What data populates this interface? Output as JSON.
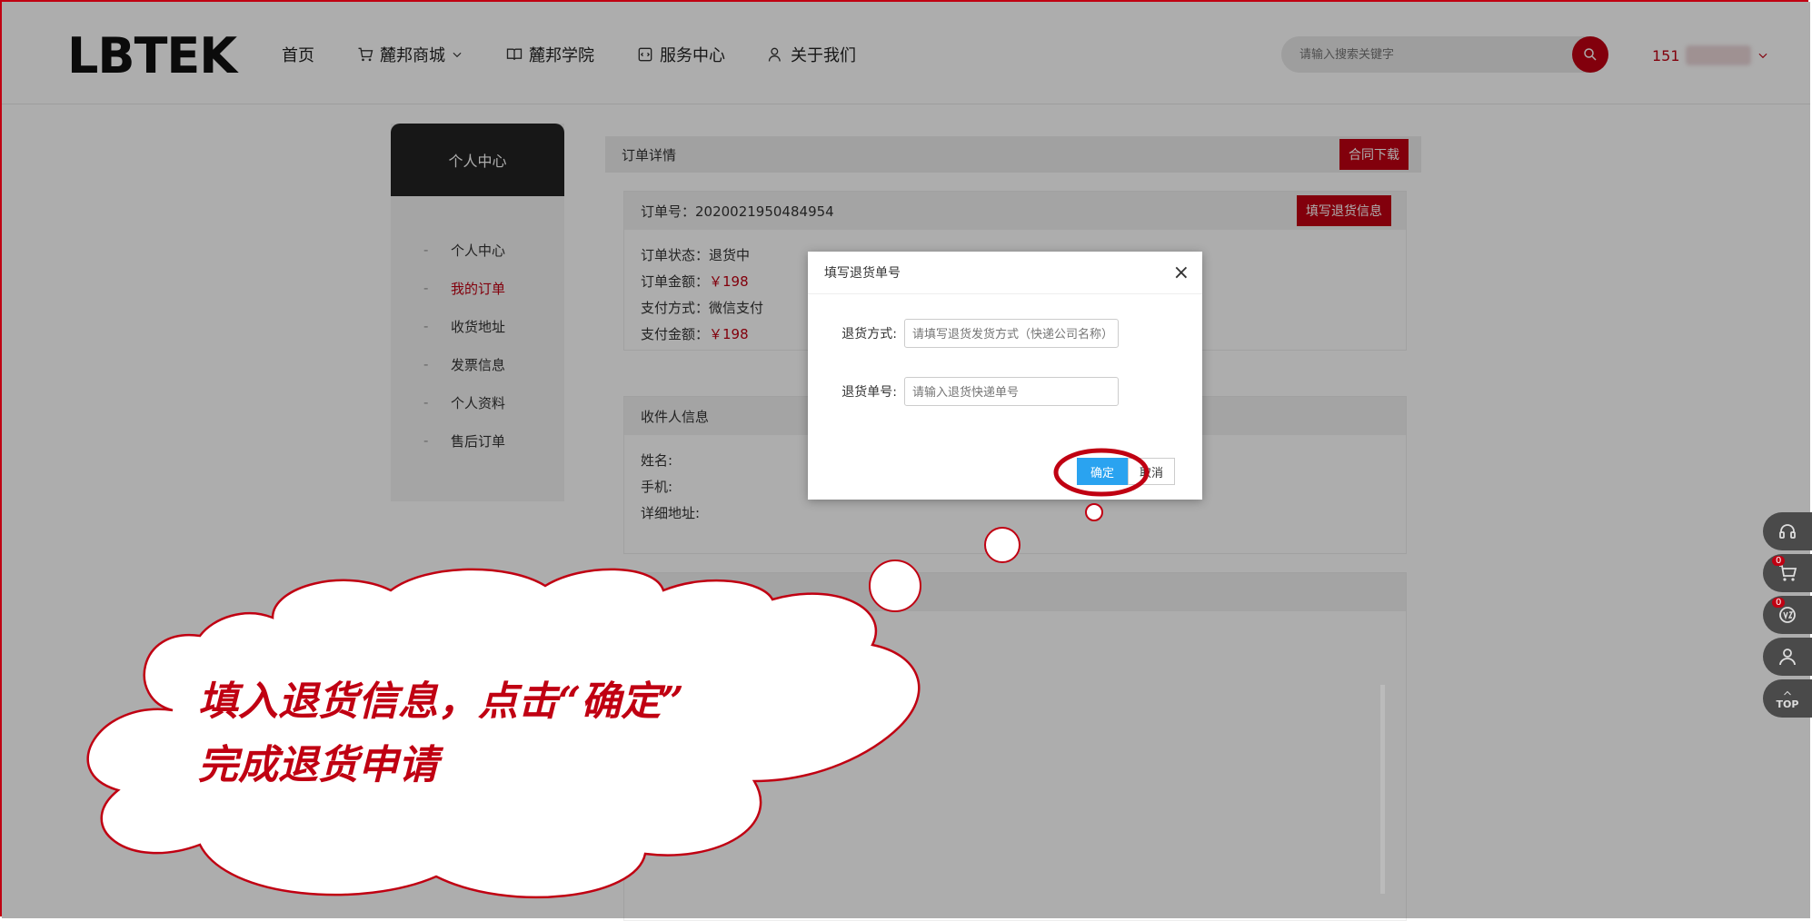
{
  "header": {
    "logo": "LBTEK",
    "nav": [
      "首页",
      "麓邦商城",
      "麓邦学院",
      "服务中心",
      "关于我们"
    ],
    "search_placeholder": "请输入搜索关键字",
    "user_prefix": "151"
  },
  "sidebar": {
    "title": "个人中心",
    "items": [
      {
        "label": "个人中心",
        "active": false
      },
      {
        "label": "我的订单",
        "active": true
      },
      {
        "label": "收货地址",
        "active": false
      },
      {
        "label": "发票信息",
        "active": false
      },
      {
        "label": "个人资料",
        "active": false
      },
      {
        "label": "售后订单",
        "active": false
      }
    ]
  },
  "content": {
    "bar_title": "订单详情",
    "download_btn": "合同下载",
    "order_no": "订单号：2020021950484954",
    "return_btn": "填写退货信息",
    "status_label": "订单状态：",
    "status_value": "退货中",
    "amount_label": "订单金额：",
    "amount_value": "￥198",
    "pay_method_label": "支付方式：",
    "pay_method_value": "微信支付",
    "pay_amount_label": "支付金额：",
    "pay_amount_value": "￥198",
    "receiver_title": "收件人信息",
    "name_label": "姓名:",
    "phone_label": "手机:",
    "address_label": "详细地址:"
  },
  "dialog": {
    "title": "填写退货单号",
    "close": "×",
    "method_label": "退货方式:",
    "method_placeholder": "请填写退货发货方式（快递公司名称）",
    "tracking_label": "退货单号:",
    "tracking_placeholder": "请输入退货快递单号",
    "ok": "确定",
    "cancel": "取消"
  },
  "float_bar": {
    "cart_count": "0",
    "compare_count": "0",
    "top_label": "TOP"
  },
  "annotation": {
    "line1": "填入退货信息，点击“确定”",
    "line2": "完成退货申请"
  },
  "colors": {
    "brand_red": "#c00012",
    "primary_blue": "#2aa3f0",
    "annotation_red": "#c00012"
  }
}
